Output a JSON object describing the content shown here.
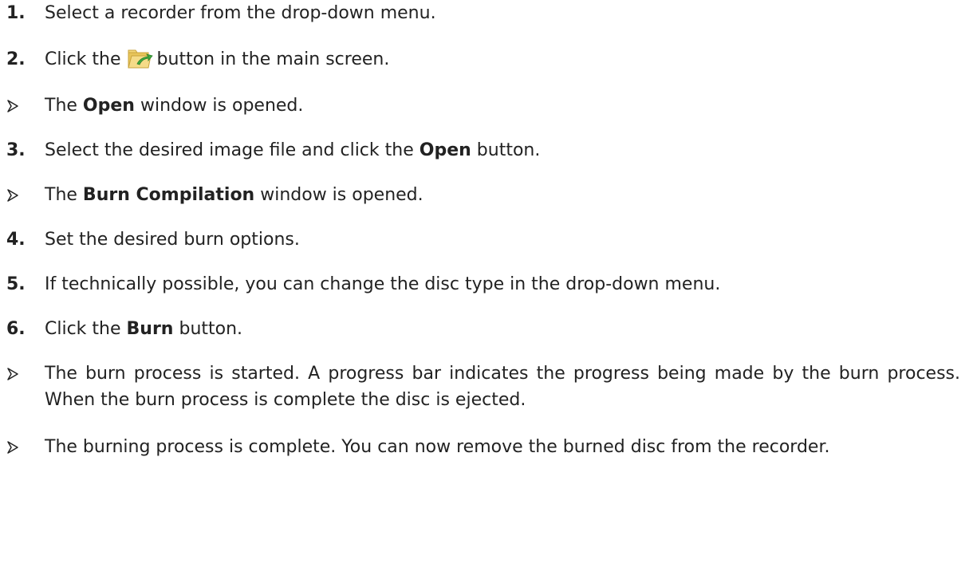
{
  "steps": [
    {
      "marker": "1.",
      "text": "Select a recorder from the drop-down menu."
    },
    {
      "marker": "2.",
      "before": "Click the",
      "icon": "folder-burn-icon",
      "after": "button in the main screen."
    },
    {
      "before": "The",
      "bold": "Open",
      "after": "window is opened."
    },
    {
      "marker": "3.",
      "before": "Select the desired image file and click the",
      "bold": "Open",
      "after": "button."
    },
    {
      "before": "The",
      "bold": "Burn Compilation",
      "after": "window is opened."
    },
    {
      "marker": "4.",
      "text": "Set the desired burn options."
    },
    {
      "marker": "5.",
      "text": "If technically possible, you can change the disc type in the drop-down menu."
    },
    {
      "marker": "6.",
      "before": "Click the",
      "bold": "Burn",
      "after": "button."
    },
    {
      "text": "The burn process is started. A progress bar indicates the progress being made by the burn process. When the burn process is complete the disc is ejected."
    },
    {
      "text": "The burning process is complete. You can now remove the burned disc from the recorder."
    }
  ],
  "colors": {
    "text": "#222222",
    "folder": "#e8c55a",
    "arrow_green": "#3faa3f"
  }
}
